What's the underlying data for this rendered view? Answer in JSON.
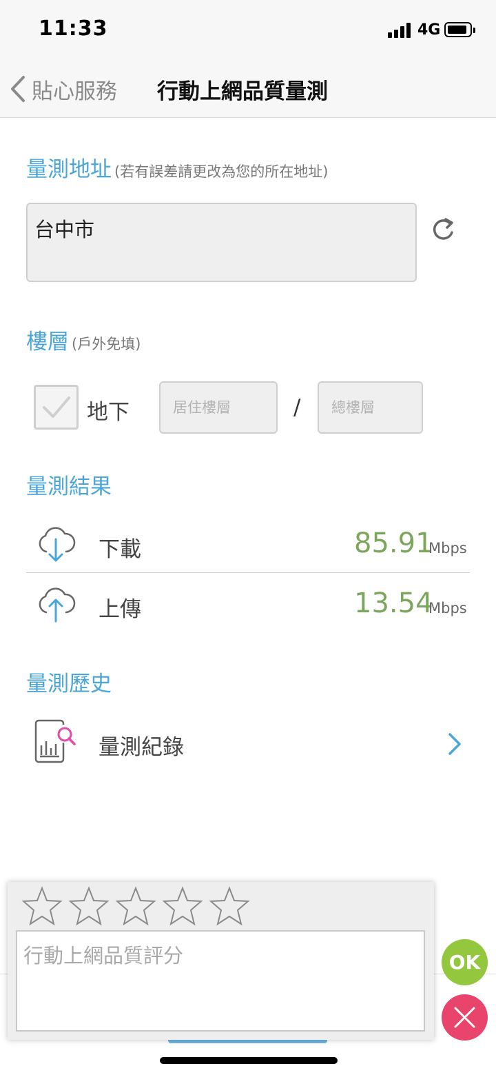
{
  "status": {
    "time": "11:33",
    "network": "4G"
  },
  "nav": {
    "back_label": "貼心服務",
    "title": "行動上網品質量測"
  },
  "address": {
    "title": "量測地址",
    "hint": "(若有誤差請更改為您的所在地址)",
    "value": "台中市"
  },
  "floor": {
    "title": "樓層",
    "hint": "(戶外免填)",
    "basement_label": "地下",
    "basement_checked": false,
    "floor_placeholder": "居住樓層",
    "total_placeholder": "總樓層",
    "separator": "/"
  },
  "results": {
    "title": "量測結果",
    "download": {
      "label": "下載",
      "value": "85.91",
      "unit": "Mbps"
    },
    "upload": {
      "label": "上傳",
      "value": "13.54",
      "unit": "Mbps"
    },
    "value_color": "#7ba65b"
  },
  "history": {
    "title": "量測歷史",
    "record_label": "量測紀錄"
  },
  "rating": {
    "stars_total": 5,
    "stars_selected": 0,
    "placeholder": "行動上網品質評分",
    "ok_label": "OK"
  },
  "colors": {
    "accent": "#4aa6d9",
    "ok": "#93c83e",
    "close": "#e8446c"
  }
}
